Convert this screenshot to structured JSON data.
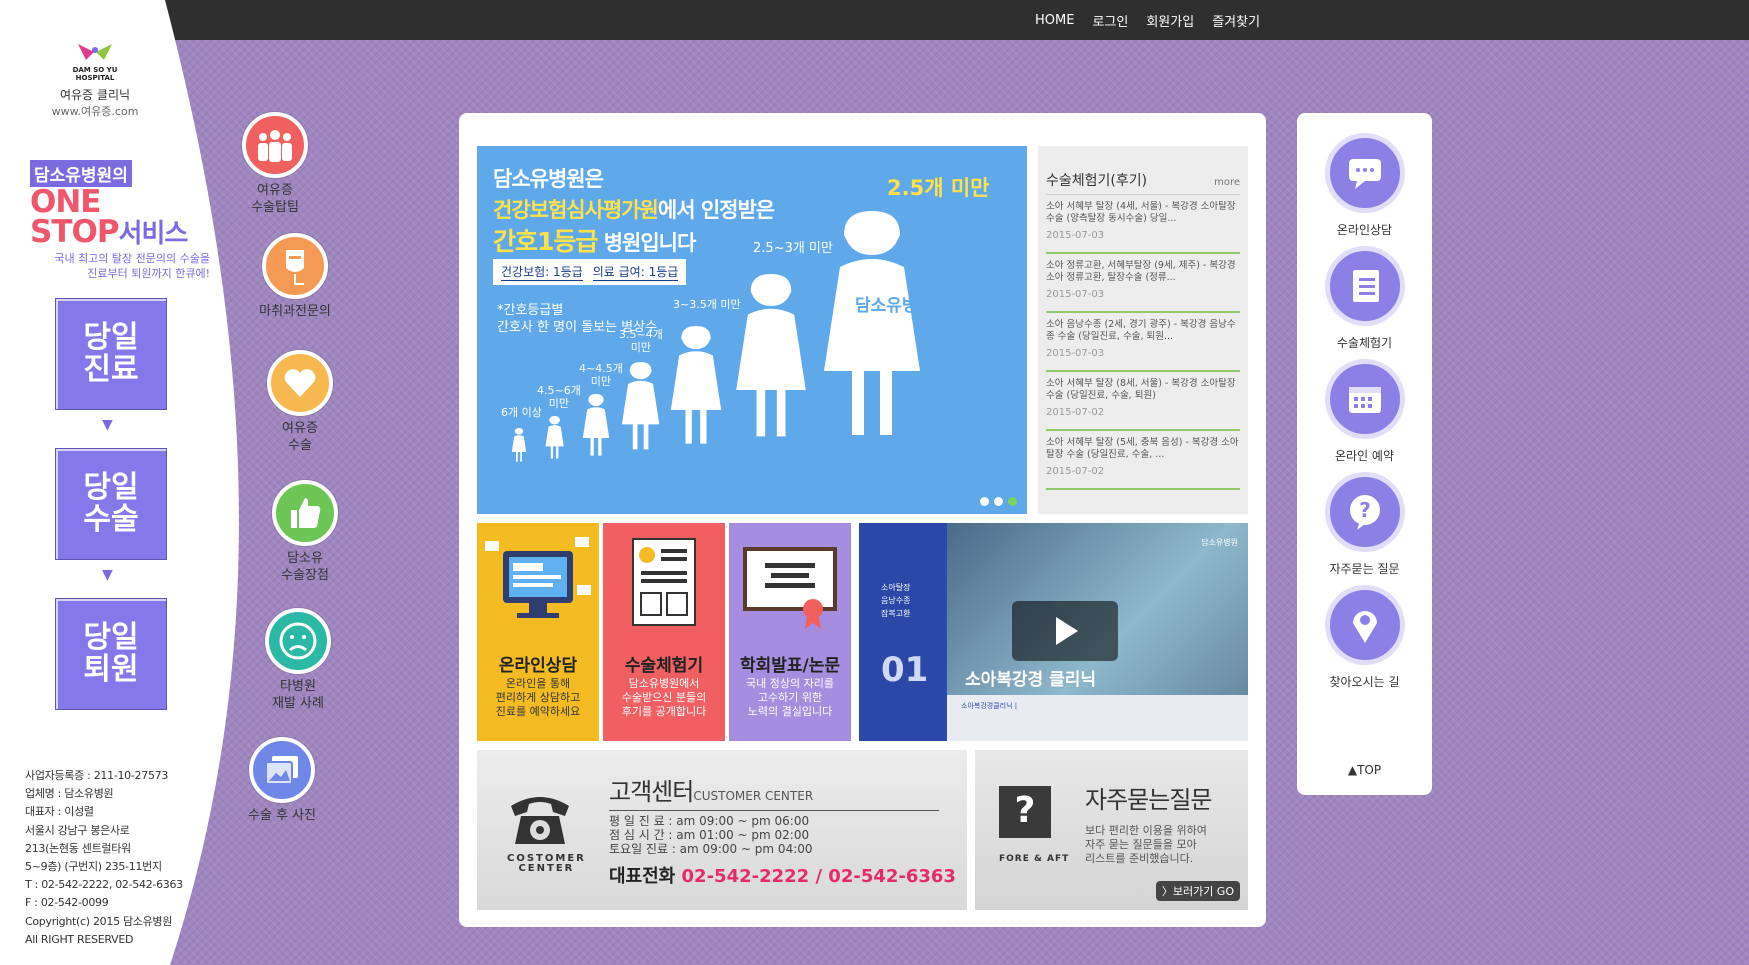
{
  "topnav": [
    "HOME",
    "로그인",
    "회원가입",
    "즐겨찾기"
  ],
  "logo": {
    "brand": "DAM SO YU",
    "sub": "HOSPITAL",
    "name": "여유증 클리닉",
    "url": "www.여유증.com"
  },
  "promo": {
    "tag": "담소유병원의",
    "line1": "ONE",
    "line2": "STOP",
    "line2b": "서비스",
    "sub1": "국내 최고의 탈장 전문의의 수술을",
    "sub2": "진료부터 퇴원까지 한큐에!"
  },
  "steps": [
    {
      "l1": "당일",
      "l2": "진료"
    },
    {
      "l1": "당일",
      "l2": "수술"
    },
    {
      "l1": "당일",
      "l2": "퇴원"
    }
  ],
  "step_arrow": "▼",
  "info": [
    "사업자등록증 : 211-10-27573",
    "업체명 : 담소유병원",
    "대표자 : 이성렬",
    "서울시 강남구 봉은사로",
    "213(논현동 센트럴타워",
    "5~9층) (구번지) 235-11번지",
    "T : 02-542-2222, 02-542-6363",
    "F : 02-542-0099",
    "Copyright(c) 2015 담소유병원",
    "All RIGHT RESERVED"
  ],
  "sideicons": [
    {
      "icon": "doctors-icon",
      "l1": "여유증",
      "l2": "수술탑팀",
      "color": "#f0605e"
    },
    {
      "icon": "iv-drip-icon",
      "l1": "마취과전문의",
      "l2": "",
      "color": "#f59a55"
    },
    {
      "icon": "heart-icon",
      "l1": "여유증",
      "l2": "수술",
      "color": "#f7b850"
    },
    {
      "icon": "thumbs-up-icon",
      "l1": "담소유",
      "l2": "수술장점",
      "color": "#6cc554"
    },
    {
      "icon": "sad-face-icon",
      "l1": "타병원",
      "l2": "재발 사례",
      "color": "#2bb9a6"
    },
    {
      "icon": "photos-icon",
      "l1": "수술 후 사진",
      "l2": "",
      "color": "#6f87e6"
    }
  ],
  "banner": {
    "l1": "담소유병원은",
    "l2y": "건강보험심사평가원",
    "l2": "에서 인정받은",
    "l3y": "간호1등급",
    "l3": " 병원입니다",
    "check1": "건강보험: 1등급",
    "check2": "의료 급여: 1등급",
    "note1": "*간호등급별",
    "note2": "간호사 한 명이 돌보는 병상수",
    "rate": "2.5개 미만",
    "nurse_label": "담소유병원",
    "labels": [
      "6개 이상",
      "4.5~6개\n미만",
      "4~4.5개\n미만",
      "3.5~4개\n미만",
      "3~3.5개 미만",
      "2.5~3개 미만"
    ]
  },
  "review": {
    "title": "수술체험기(후기)",
    "more": "more",
    "items": [
      {
        "text": "소아 서혜부 탈장 (4세, 서울) - 복강경 소아탈장 수술 (양측탈장 동시수술) 당일...",
        "date": "2015-07-03"
      },
      {
        "text": "소아 정류고환, 서혜부탈장 (9세, 제주) - 복강경 소아 정류고환, 탈장수술 (정류...",
        "date": "2015-07-03"
      },
      {
        "text": "소아 음낭수종 (2세, 경기 광주) - 복강경 음낭수종 수술 (당일진료, 수술, 퇴원...",
        "date": "2015-07-03"
      },
      {
        "text": "소아 서혜부 탈장 (8세, 서울) - 복강경 소아탈장 수술 (당일진료, 수술, 퇴원)",
        "date": "2015-07-02"
      },
      {
        "text": "소아 서혜부 탈장 (5세, 충북 음성) - 복강경 소아탈장 수술 (당일진료, 수술, ...",
        "date": "2015-07-02"
      }
    ]
  },
  "cards": [
    {
      "title": "온라인상담",
      "desc": "온라인을 통해\n편리하게 상담하고\n진료를 예약하세요",
      "bg": "#f4bc22",
      "fg": "#333"
    },
    {
      "title": "수술체험기",
      "desc": "담소유병원에서\n수술받으신 분들의\n후기를 공개합니다",
      "bg": "#f05f61",
      "fg": "#fff"
    },
    {
      "title": "학회발표/논문",
      "desc": "국내 정상의 자리를\n고수하기 위한\n노력의 결실입니다",
      "bg": "#a78de0",
      "fg": "#fff"
    }
  ],
  "video": {
    "side": "소아탈장\n음낭수종\n잠복고환",
    "num": "01",
    "caption": "소아복강경 클리닉",
    "small": "소아복강경클리닉 |",
    "logo": "담소유병원"
  },
  "customer": {
    "title": "고객센터",
    "title_en": "CUSTOMER CENTER",
    "label": "COSTOMER\nCENTER",
    "hours": [
      "평 일 진 료 : am 09:00 ~ pm 06:00",
      "점 심 시 간 : am 01:00 ~ pm 02:00",
      "토요일 진료 : am 09:00 ~ pm 04:00"
    ],
    "tel_label": "대표전화",
    "tel": "02-542-2222 / 02-542-6363"
  },
  "faq": {
    "title": "자주묻는질문",
    "label": "FORE & AFT",
    "desc": "보다 편리한 이용을 위하여\n자주 묻는 질문들을 모아\n리스트를 준비했습니다.",
    "go": "〉보러가기 GO"
  },
  "quick": [
    {
      "icon": "chat-icon",
      "label": "온라인상담"
    },
    {
      "icon": "notebook-icon",
      "label": "수술체험기"
    },
    {
      "icon": "calendar-icon",
      "label": "온라인 예약"
    },
    {
      "icon": "question-icon",
      "label": "자주묻는 질문"
    },
    {
      "icon": "map-pin-icon",
      "label": "찾아오시는 길"
    }
  ],
  "top": "▲TOP"
}
